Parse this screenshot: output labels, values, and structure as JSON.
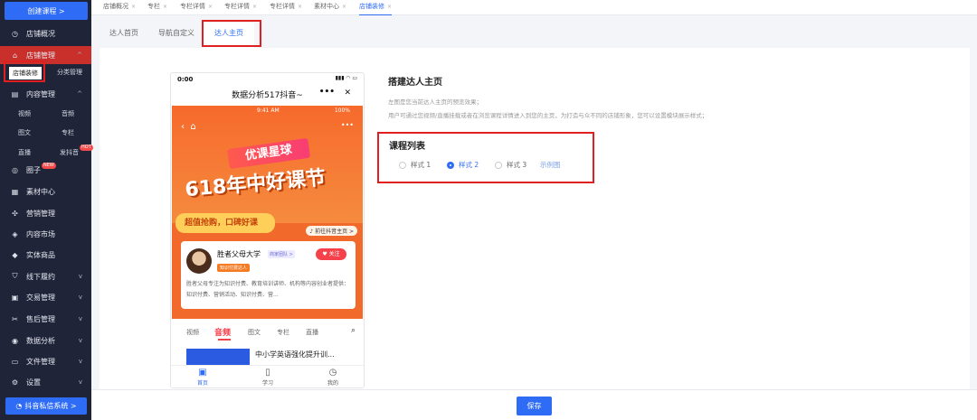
{
  "sidebar": {
    "create_button": "创建课程 >",
    "menu": [
      {
        "label": "店铺概况",
        "icon": "clock-icon"
      },
      {
        "label": "店铺管理",
        "icon": "store-icon"
      },
      {
        "label": "内容管理",
        "icon": "document-icon"
      },
      {
        "label": "圈子",
        "icon": "circle-icon",
        "badge": "NEW"
      },
      {
        "label": "素材中心",
        "icon": "folder-icon"
      },
      {
        "label": "营销管理",
        "icon": "gear-icon"
      },
      {
        "label": "内容市场",
        "icon": "layers-icon"
      },
      {
        "label": "实体商品",
        "icon": "bag-icon"
      },
      {
        "label": "线下履约",
        "icon": "shield-icon"
      },
      {
        "label": "交易管理",
        "icon": "receipt-icon"
      },
      {
        "label": "售后管理",
        "icon": "scissors-icon"
      },
      {
        "label": "数据分析",
        "icon": "chart-icon"
      },
      {
        "label": "文件管理",
        "icon": "file-icon"
      },
      {
        "label": "设置",
        "icon": "settings-icon"
      }
    ],
    "store_sub": [
      "店铺装修",
      "分类管理"
    ],
    "content_sub": [
      "视频",
      "音频",
      "图文",
      "专栏",
      "直播",
      "发抖音"
    ],
    "content_badge": "HOT",
    "bottom_button": "抖音私信系统 >"
  },
  "top_tabs": [
    "店铺概况",
    "专栏",
    "专栏详情",
    "专栏详情",
    "专栏详情",
    "素材中心",
    "店铺装修"
  ],
  "sub_tabs": [
    "达人首页",
    "导航自定义",
    "达人主页"
  ],
  "phone": {
    "time": "0:00",
    "title": "数据分析517抖音~",
    "inner_time": "9:41 AM",
    "battery": "100%",
    "banner1": "优课星球",
    "banner2": "618年中好课节",
    "ribbon": "超值抢购，口碑好课",
    "link": "前往抖音主页 >",
    "name": "胜者父母大学",
    "tag1": "商家团队 >",
    "tag2": "知识付费达人",
    "follow": "关注",
    "desc": "胜者父母专注为知识付费、教育培训讲师、机构等内容创业者提供：知识付费、营销活动、知识付费、营...",
    "tabs": [
      "视频",
      "音频",
      "图文",
      "专栏",
      "直播"
    ],
    "course_title": "中小学英语强化提升训...",
    "bottom_nav": [
      "首页",
      "学习",
      "我的"
    ]
  },
  "panel": {
    "title": "搭建达人主页",
    "desc1": "左图是您当前达人主页的预览效果；",
    "desc2": "用户可通过您视频/直播挂载或者在浏览课程详情进入到您的主页，为打造与众不同的店铺形象，您可以设置模块展示样式；",
    "section": "课程列表",
    "options": [
      "样式 1",
      "样式 2",
      "样式 3"
    ],
    "selected": "样式 2",
    "example": "示例图"
  },
  "save": "保存",
  "colors": {
    "accent": "#2f6cf6",
    "sidebar": "#1f2438",
    "highlight": "#e02020"
  }
}
